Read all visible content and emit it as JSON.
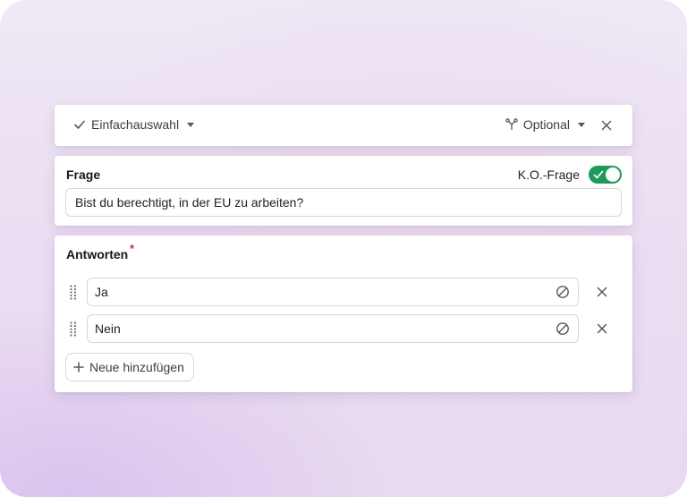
{
  "header": {
    "question_type": "Einfachauswahl",
    "visibility": "Optional"
  },
  "question": {
    "label": "Frage",
    "ko_label": "K.O.-Frage",
    "ko_enabled": true,
    "value": "Bist du berechtigt, in der EU zu arbeiten?"
  },
  "answers": {
    "label": "Antworten",
    "required_marker": "*",
    "items": [
      {
        "value": "Ja"
      },
      {
        "value": "Nein"
      }
    ],
    "add_label": "Neue hinzufügen"
  },
  "colors": {
    "toggle_on": "#1e9b5a",
    "required": "#d6204e",
    "border": "#d6d6dc"
  },
  "icons": {
    "type": "check-icon",
    "visibility": "branch-icon",
    "dropdown": "caret-down-icon",
    "close": "close-icon",
    "drag": "drag-handle-icon",
    "ban": "ban-icon",
    "add": "plus-icon"
  }
}
